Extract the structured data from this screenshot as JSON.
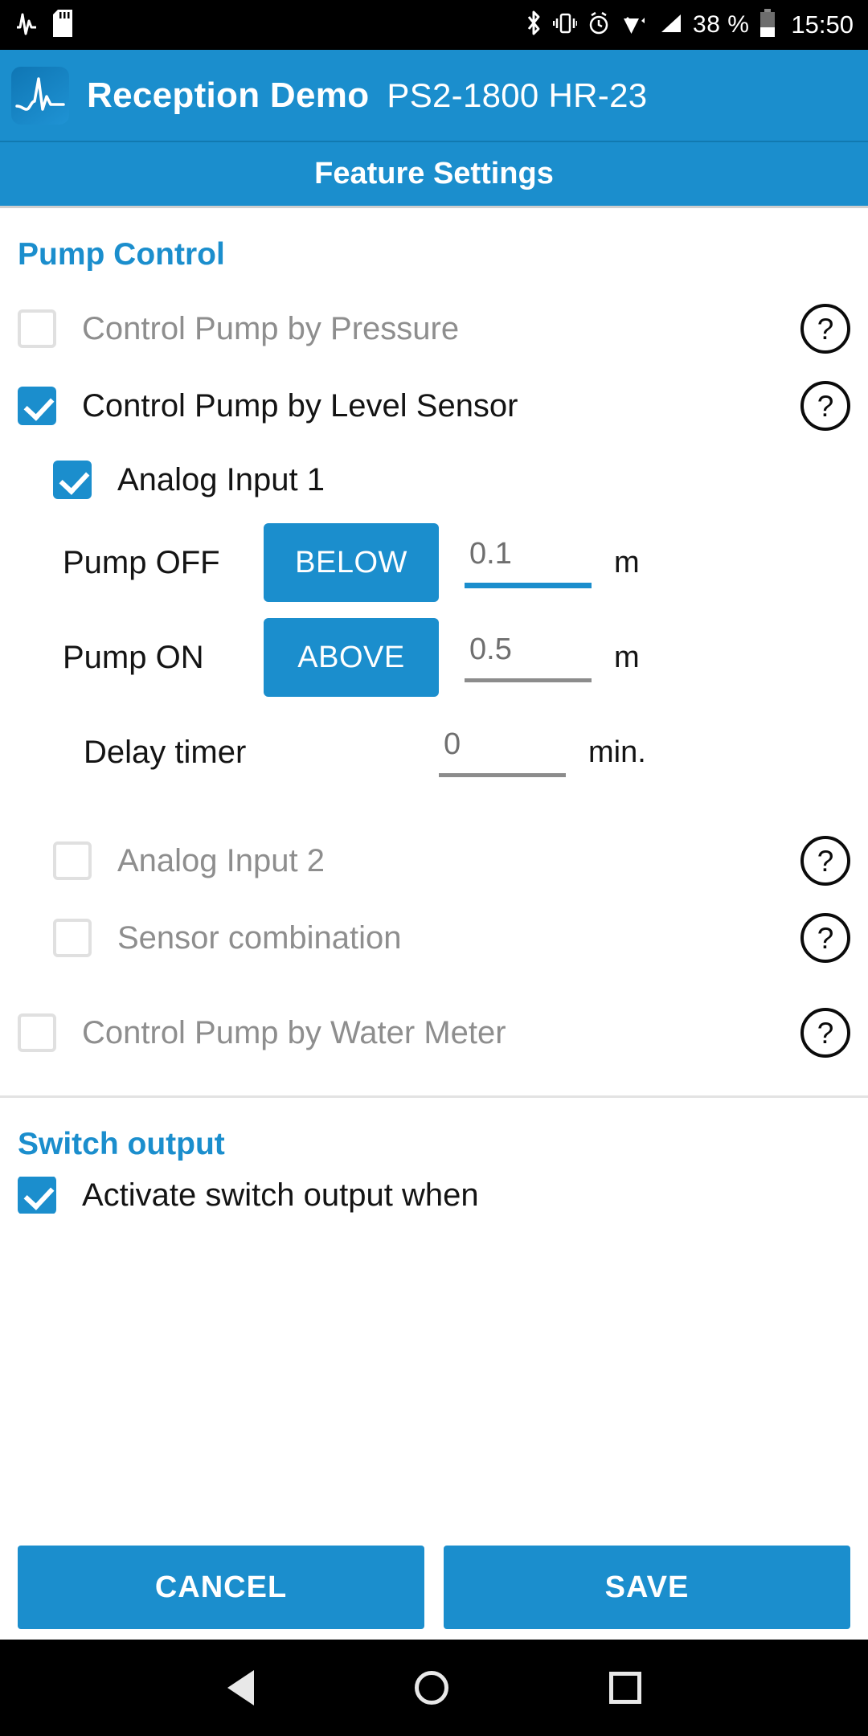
{
  "statusbar": {
    "icons_left": [
      "waveform-notification-icon",
      "sd-card-icon"
    ],
    "icons_right": [
      "bluetooth-icon",
      "vibrate-icon",
      "alarm-icon",
      "wifi-icon",
      "signal-icon"
    ],
    "battery_percent": "38 %",
    "time": "15:50"
  },
  "appbar": {
    "logo": "waveform-logo-icon",
    "title": "Reception Demo",
    "subtitle": "PS2-1800 HR-23"
  },
  "subheader": {
    "title": "Feature Settings"
  },
  "sections": {
    "pump_control": {
      "title": "Pump Control",
      "rows": [
        {
          "label": "Control Pump by Pressure",
          "checked": false,
          "enabled": false,
          "help": "?"
        },
        {
          "label": "Control Pump by Level Sensor",
          "checked": true,
          "enabled": true,
          "help": "?"
        }
      ],
      "analog_input_1": {
        "label": "Analog Input 1",
        "checked": true,
        "pump_off": {
          "label": "Pump OFF",
          "condition": "BELOW",
          "value": "0.1",
          "unit": "m",
          "focused": true
        },
        "pump_on": {
          "label": "Pump ON",
          "condition": "ABOVE",
          "value": "0.5",
          "unit": "m",
          "focused": false
        },
        "delay_timer": {
          "label": "Delay timer",
          "value": "0",
          "unit": "min.",
          "focused": false
        }
      },
      "sub_rows": [
        {
          "label": "Analog Input 2",
          "checked": false,
          "enabled": false,
          "help": "?"
        },
        {
          "label": "Sensor combination",
          "checked": false,
          "enabled": false,
          "help": "?"
        }
      ],
      "water_meter_row": {
        "label": "Control Pump by Water Meter",
        "checked": false,
        "enabled": false,
        "help": "?"
      }
    },
    "switch_output": {
      "title": "Switch output",
      "cut_off_label": "Activate switch output when"
    }
  },
  "footer": {
    "cancel_label": "CANCEL",
    "save_label": "SAVE"
  },
  "navbar": {
    "back": "back-triangle-icon",
    "home": "home-circle-icon",
    "recents": "recents-square-icon"
  },
  "colors": {
    "accent": "#1b8ecd",
    "disabled_text": "#8e8e8e",
    "text": "#141414"
  }
}
